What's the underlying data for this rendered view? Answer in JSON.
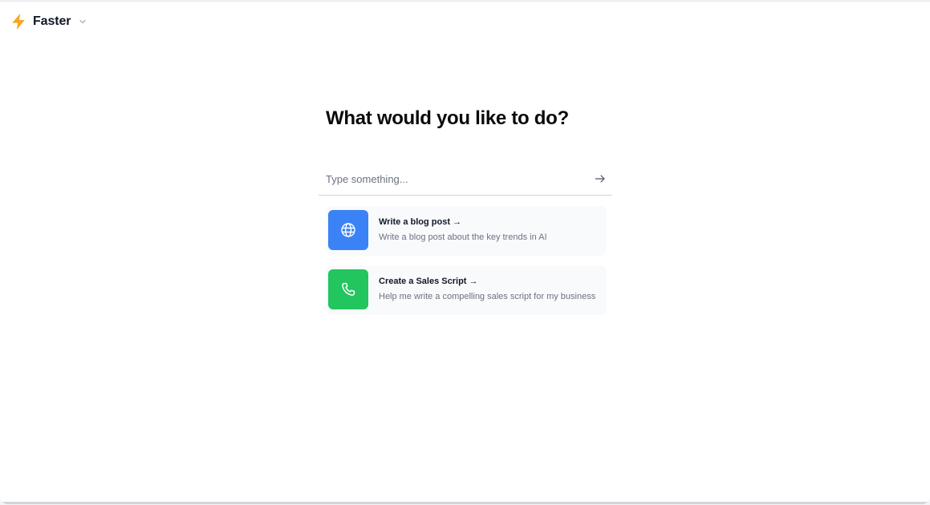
{
  "brand": {
    "name": "Faster",
    "icon": "lightning-bolt-icon",
    "dropdown_icon": "chevron-down-icon"
  },
  "main": {
    "heading": "What would you like to do?",
    "input": {
      "placeholder": "Type something...",
      "value": "",
      "submit_icon": "arrow-right-icon"
    }
  },
  "suggestions": [
    {
      "title": "Write a blog post →",
      "subtitle": "Write a blog post about the key trends in AI",
      "icon": "globe-icon",
      "color": "#3b82f6"
    },
    {
      "title": "Create a Sales Script →",
      "subtitle": "Help me write a compelling sales script for my business",
      "icon": "phone-icon",
      "color": "#22c55e"
    }
  ],
  "colors": {
    "accent_bolt": "#f5a623",
    "blue_tile": "#3b82f6",
    "green_tile": "#22c55e"
  }
}
